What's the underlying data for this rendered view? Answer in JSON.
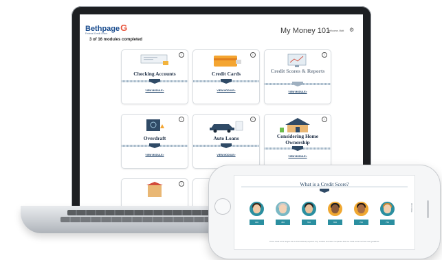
{
  "laptop": {
    "logo_text": "Bethpage",
    "logo_sub": "Federal Credit Union",
    "progress": "3 of 16 modules completed",
    "app_title": "My Money 101",
    "welcome": "Welcome, Matt",
    "cards": [
      {
        "title": "Checking Accounts",
        "view": "VIEW MODULE>",
        "completed": true
      },
      {
        "title": "Credit Cards",
        "view": "VIEW MODULE>",
        "completed": false
      },
      {
        "title": "Credit Scores & Reports",
        "view": "VIEW MODULE>",
        "completed": false
      },
      {
        "title": "Overdraft",
        "view": "VIEW MODULE>",
        "completed": true
      },
      {
        "title": "Auto Loans",
        "view": "VIEW MODULE>",
        "completed": true
      },
      {
        "title": "Considering Home Ownership",
        "view": "VIEW MODULE>",
        "completed": false
      }
    ]
  },
  "phone": {
    "title": "What is a Credit Score?",
    "note": "These credit score ranges are for informational purposes only. Lenders and other companies that use credit scores set their own guidelines.",
    "side_label": "ON PAGE",
    "scores": [
      "300",
      "450",
      "550",
      "650",
      "700",
      "750"
    ]
  },
  "colors": {
    "brand_blue": "#1b4d8f",
    "brand_orange": "#e8543b",
    "check_green": "#6dbb4b",
    "ribbon_navy": "#2f4a66",
    "teal": "#2b8fa0"
  }
}
